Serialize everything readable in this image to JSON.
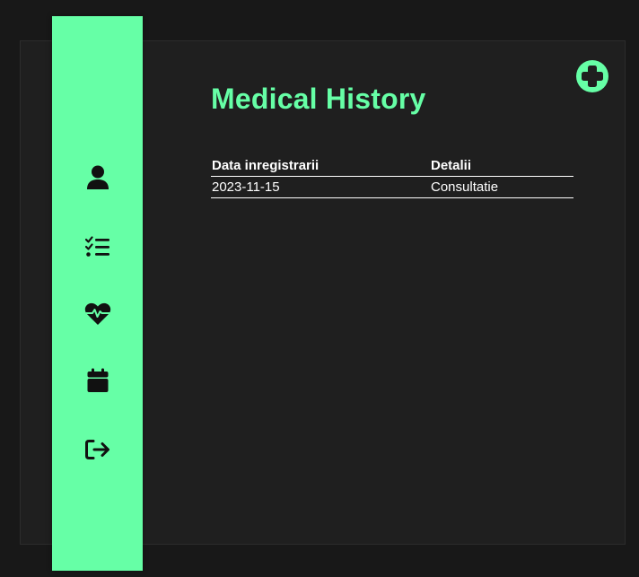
{
  "app": {
    "accent_color": "#66ffa6",
    "background_color": "#181818"
  },
  "sidebar": {
    "items": [
      {
        "id": "profile",
        "icon": "user-icon"
      },
      {
        "id": "tasks",
        "icon": "checklist-icon"
      },
      {
        "id": "medical-history",
        "icon": "heart-pulse-icon"
      },
      {
        "id": "appointments",
        "icon": "calendar-icon"
      },
      {
        "id": "logout",
        "icon": "logout-icon"
      }
    ]
  },
  "main": {
    "title": "Medical History",
    "add_button_icon": "plus-circle-icon",
    "table": {
      "columns": [
        "Data inregistrarii",
        "Detalii"
      ],
      "rows": [
        [
          "2023-11-15",
          "Consultatie"
        ]
      ]
    }
  }
}
